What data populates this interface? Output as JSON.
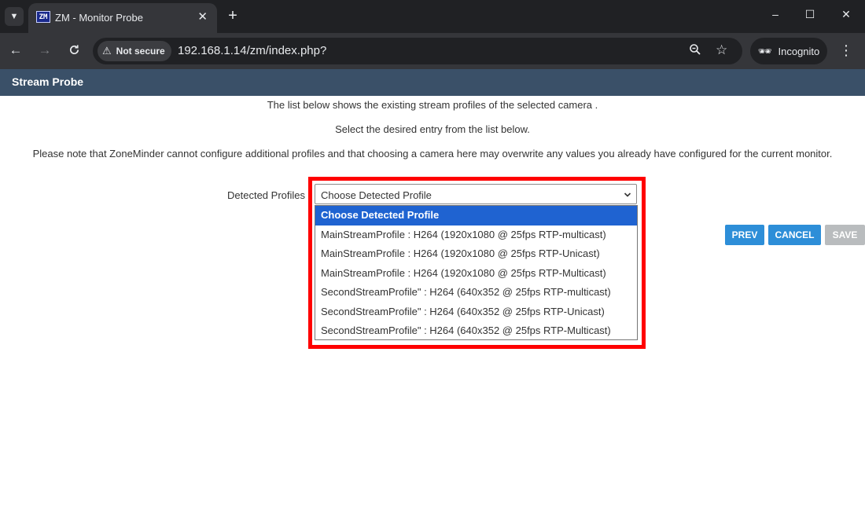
{
  "browser": {
    "tab_menu_icon": "chevron-down-icon",
    "tab": {
      "favicon_text": "ZM",
      "title": "ZM - Monitor Probe"
    },
    "new_tab_glyph": "+",
    "window": {
      "minimize": "–",
      "maximize": "☐",
      "close": "✕"
    },
    "nav": {
      "back": "←",
      "forward": "→",
      "reload": "C"
    },
    "security_label": "Not secure",
    "url": "192.168.1.14/zm/index.php?",
    "zoom_icon": "zoom-icon",
    "bookmark_icon": "star-icon",
    "incognito_label": "Incognito",
    "menu_glyph": "⋮"
  },
  "page": {
    "header_title": "Stream Probe",
    "info": [
      "The list below shows the existing stream profiles of the selected camera .",
      "Select the desired entry from the list below.",
      "Please note that ZoneMinder cannot configure additional profiles and that choosing a camera here may overwrite any values you already have configured for the current monitor."
    ],
    "profiles_label": "Detected Profiles",
    "select_value": "Choose Detected Profile",
    "options": [
      "Choose Detected Profile",
      "MainStreamProfile : H264 (1920x1080 @ 25fps RTP-multicast)",
      "MainStreamProfile : H264 (1920x1080 @ 25fps RTP-Unicast)",
      "MainStreamProfile : H264 (1920x1080 @ 25fps RTP-Multicast)",
      "SecondStreamProfile\" : H264 (640x352 @ 25fps RTP-multicast)",
      "SecondStreamProfile\" : H264 (640x352 @ 25fps RTP-Unicast)",
      "SecondStreamProfile\" : H264 (640x352 @ 25fps RTP-Multicast)"
    ],
    "buttons": {
      "prev": "PREV",
      "cancel": "CANCEL",
      "save": "SAVE"
    }
  },
  "colors": {
    "header_bg": "#3a5068",
    "highlight": "#ff0000",
    "option_selected_bg": "#1f63d1",
    "button_primary": "#2d8ed8",
    "button_disabled": "#b9bcbe"
  }
}
